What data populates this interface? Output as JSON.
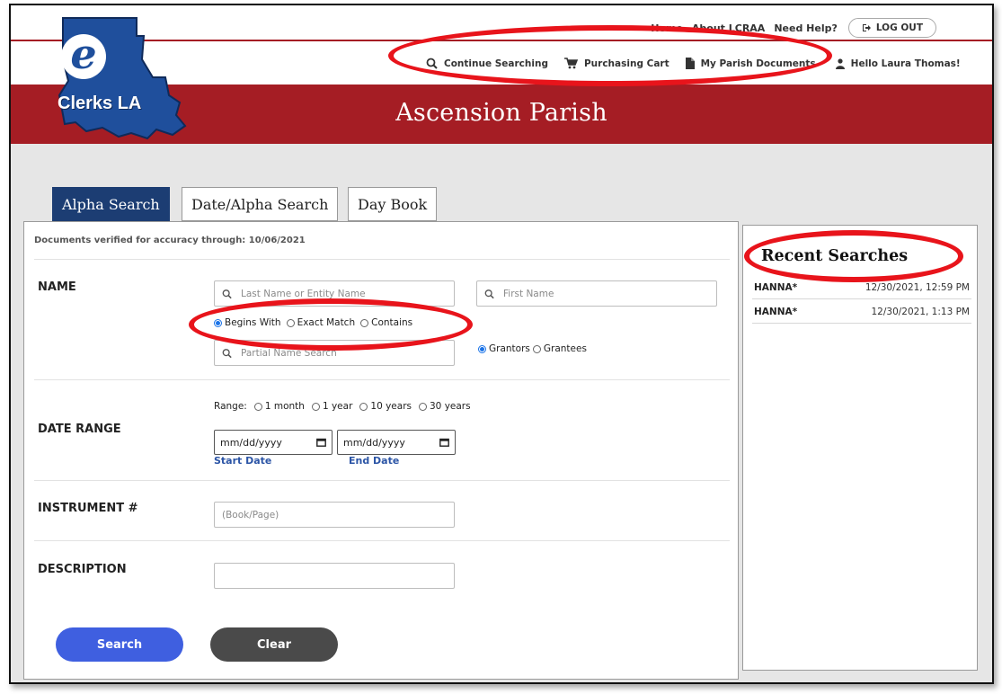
{
  "util_nav": {
    "home": "Home",
    "about": "About LCRAA",
    "help": "Need Help?",
    "logout": "LOG OUT"
  },
  "main_nav": {
    "continue": "Continue Searching",
    "cart": "Purchasing Cart",
    "parish_docs": "My Parish Documents",
    "greeting": "Hello Laura Thomas!"
  },
  "logo": {
    "letter": "e",
    "text": "Clerks LA"
  },
  "page_title": "Ascension Parish",
  "tabs": [
    {
      "label": "Alpha Search",
      "active": true
    },
    {
      "label": "Date/Alpha Search",
      "active": false
    },
    {
      "label": "Day Book",
      "active": false
    }
  ],
  "form": {
    "verified": "Documents verified for accuracy through: 10/06/2021",
    "name_label": "NAME",
    "last_name_placeholder": "Last Name or Entity Name",
    "first_name_placeholder": "First Name",
    "match_options": [
      {
        "label": "Begins With",
        "selected": true
      },
      {
        "label": "Exact Match",
        "selected": false
      },
      {
        "label": "Contains",
        "selected": false
      }
    ],
    "partial_placeholder": "Partial Name Search",
    "party_options": [
      {
        "label": "Grantors",
        "selected": true
      },
      {
        "label": "Grantees",
        "selected": false
      }
    ],
    "date_range_label": "DATE RANGE",
    "range_prefix": "Range:",
    "range_options": [
      {
        "label": "1 month",
        "selected": false
      },
      {
        "label": "1 year",
        "selected": false
      },
      {
        "label": "10 years",
        "selected": false
      },
      {
        "label": "30 years",
        "selected": false
      }
    ],
    "date_placeholder": "mm/dd/yyyy",
    "start_date_label": "Start Date",
    "end_date_label": "End Date",
    "instrument_label": "INSTRUMENT #",
    "instrument_placeholder": "(Book/Page)",
    "description_label": "DESCRIPTION",
    "search_button": "Search",
    "clear_button": "Clear"
  },
  "recent": {
    "title": "Recent Searches",
    "items": [
      {
        "term": "HANNA*",
        "when": "12/30/2021, 12:59 PM"
      },
      {
        "term": "HANNA*",
        "when": "12/30/2021, 1:13 PM"
      }
    ]
  },
  "colors": {
    "brand_red": "#a51d24",
    "tab_active": "#1c3d73",
    "search_button": "#3f5fe0",
    "annotation": "#e8141b"
  }
}
